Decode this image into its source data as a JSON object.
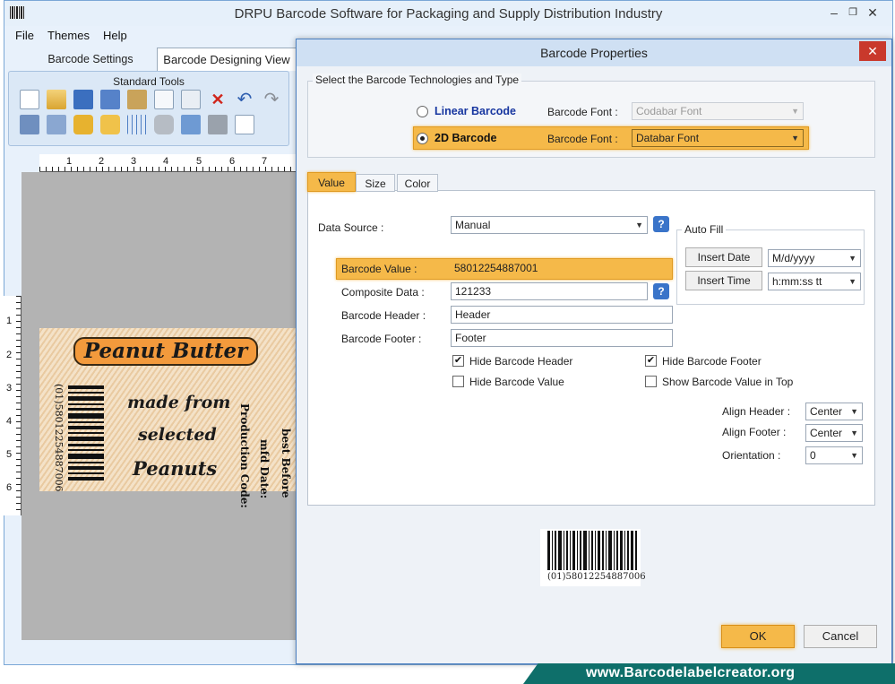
{
  "app": {
    "title": "DRPU Barcode Software for Packaging and Supply Distribution Industry",
    "window_buttons": [
      "–",
      "🗗",
      "✕"
    ]
  },
  "menu": [
    "File",
    "Themes",
    "Help"
  ],
  "main_tabs": [
    "Barcode Settings",
    "Barcode Designing View"
  ],
  "toolbar": {
    "title": "Standard Tools"
  },
  "rulers": {
    "top": [
      "1",
      "2",
      "3",
      "4",
      "5",
      "6",
      "7"
    ],
    "left": [
      "1",
      "2",
      "3",
      "4",
      "5",
      "6"
    ]
  },
  "label": {
    "title": "Peanut Butter",
    "line1": "made from",
    "line2": "selected",
    "line3": "Peanuts",
    "barcode_text": "(01)58012254887006",
    "production_code": "Production Code:",
    "mfd_date": "mfd Date:",
    "best_before": "best Before"
  },
  "dialog": {
    "title": "Barcode Properties",
    "close": "✕",
    "tech_group_label": "Select the Barcode Technologies and Type",
    "linear_label": "Linear Barcode",
    "linear_font_label": "Barcode Font :",
    "linear_font_value": "Codabar Font",
    "twod_label": "2D Barcode",
    "twod_font_label": "Barcode Font :",
    "twod_font_value": "Databar Font",
    "selected_type": "2D Barcode",
    "tabs": [
      "Value",
      "Size",
      "Color"
    ],
    "active_tab": "Value",
    "data_source_label": "Data Source :",
    "data_source_value": "Manual",
    "autofill_label": "Auto Fill",
    "insert_date_button": "Insert Date",
    "date_format": "M/d/yyyy",
    "insert_time_button": "Insert Time",
    "time_format": "h:mm:ss tt",
    "barcode_value_label": "Barcode Value :",
    "barcode_value": "58012254887001",
    "composite_label": "Composite Data :",
    "composite_value": "121233",
    "header_label": "Barcode Header :",
    "header_value": "Header",
    "footer_label": "Barcode Footer :",
    "footer_value": "Footer",
    "checkboxes": [
      {
        "label": "Hide Barcode Header",
        "checked": true
      },
      {
        "label": "Hide Barcode Footer",
        "checked": true
      },
      {
        "label": "Hide Barcode Value",
        "checked": false
      },
      {
        "label": "Show Barcode Value in Top",
        "checked": false
      }
    ],
    "align_header_label": "Align Header :",
    "align_header_value": "Center",
    "align_footer_label": "Align Footer :",
    "align_footer_value": "Center",
    "orientation_label": "Orientation :",
    "orientation_value": "0",
    "preview_text": "(01)58012254887006",
    "ok_button": "OK",
    "cancel_button": "Cancel"
  },
  "brand": "www.Barcodelabelcreator.org",
  "colors": {
    "highlight": "#f5b949",
    "brand_bar": "#0e6f6a",
    "label_title_bg": "#f39a3c",
    "dialog_border": "#4a7fc1"
  }
}
